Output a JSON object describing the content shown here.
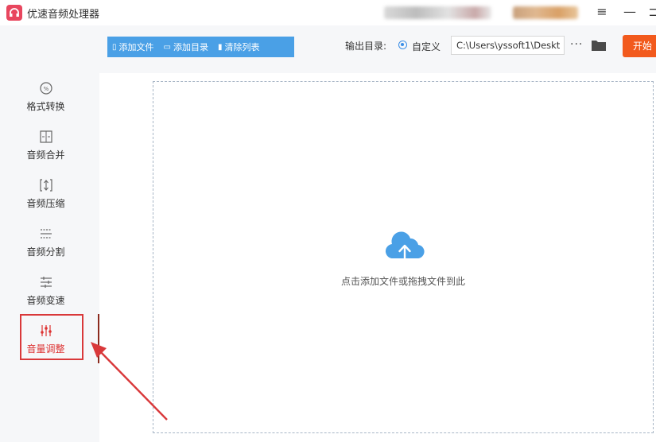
{
  "titlebar": {
    "app_title": "优速音频处理器",
    "menu_icon": "hamburger-menu-icon",
    "minimize_icon": "minimize-icon",
    "maximize_icon": "maximize-icon"
  },
  "toolbar": {
    "add_file_label": "添加文件",
    "add_folder_label": "添加目录",
    "clear_list_label": "清除列表",
    "output_dir_label": "输出目录:",
    "custom_radio_label": "自定义",
    "output_path_value": "C:\\Users\\yssoft1\\Deskt",
    "more_label": "···",
    "start_label": "开始",
    "accent_color": "#4aa0e6",
    "start_color": "#f25a1d"
  },
  "sidebar": {
    "items": [
      {
        "label": "格式转换",
        "icon": "format-convert-icon"
      },
      {
        "label": "音频合并",
        "icon": "audio-merge-icon"
      },
      {
        "label": "音频压缩",
        "icon": "audio-compress-icon"
      },
      {
        "label": "音频分割",
        "icon": "audio-split-icon"
      },
      {
        "label": "音频变速",
        "icon": "audio-speed-icon"
      },
      {
        "label": "音量调整",
        "icon": "volume-adjust-icon",
        "active": true
      }
    ],
    "highlight_color": "#d9383a"
  },
  "main": {
    "drop_hint": "点击添加文件或拖拽文件到此",
    "upload_icon": "cloud-upload-icon",
    "upload_color": "#4aa0e6"
  }
}
